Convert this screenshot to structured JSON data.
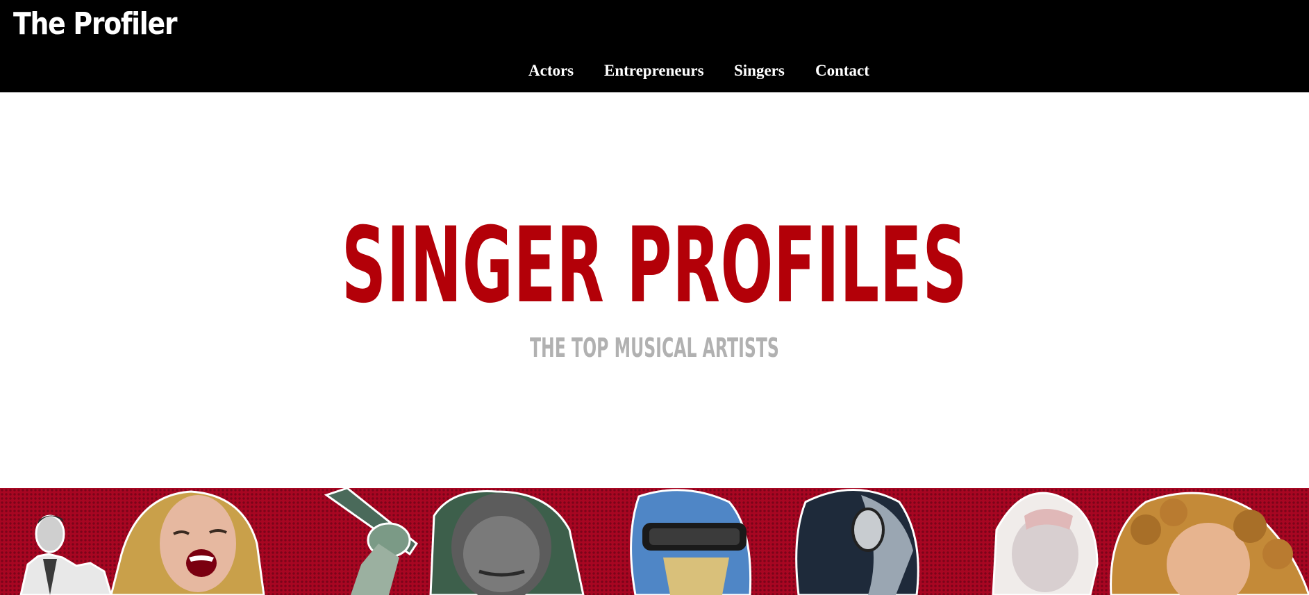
{
  "site": {
    "logo": "The Profiler"
  },
  "nav": {
    "items": [
      {
        "label": "Actors"
      },
      {
        "label": "Entrepreneurs"
      },
      {
        "label": "Singers"
      },
      {
        "label": "Contact"
      }
    ]
  },
  "hero": {
    "title": "SINGER PROFILES",
    "subtitle": "THE TOP MUSICAL ARTISTS"
  },
  "colors": {
    "header_bg": "#000000",
    "title_red": "#b30008",
    "subtitle_gray": "#b1b1b1",
    "banner_red": "#a80622"
  }
}
